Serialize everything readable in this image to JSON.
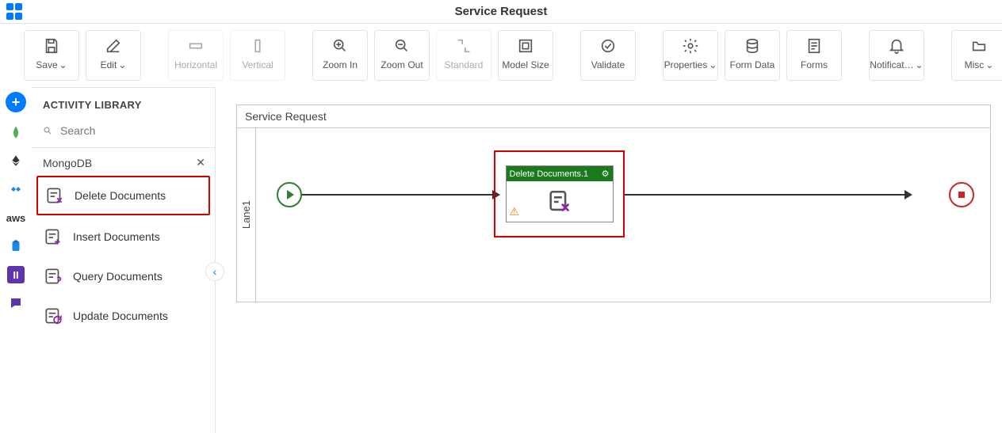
{
  "header": {
    "title": "Service Request"
  },
  "toolbar": {
    "items": [
      {
        "id": "save",
        "label": "Save",
        "chevron": true
      },
      {
        "id": "edit",
        "label": "Edit",
        "chevron": true
      },
      {
        "id": "horiz",
        "label": "Horizontal",
        "disabled": true
      },
      {
        "id": "vert",
        "label": "Vertical",
        "disabled": true
      },
      {
        "id": "zoomin",
        "label": "Zoom In"
      },
      {
        "id": "zoomout",
        "label": "Zoom Out"
      },
      {
        "id": "standard",
        "label": "Standard",
        "disabled": true
      },
      {
        "id": "modelsize",
        "label": "Model Size"
      },
      {
        "id": "validate",
        "label": "Validate"
      },
      {
        "id": "props",
        "label": "Properties",
        "chevron": true
      },
      {
        "id": "formdata",
        "label": "Form Data"
      },
      {
        "id": "forms",
        "label": "Forms"
      },
      {
        "id": "notif",
        "label": "Notificat…",
        "chevron": true
      },
      {
        "id": "misc",
        "label": "Misc",
        "chevron": true
      }
    ]
  },
  "sidebar": {
    "title": "ACTIVITY LIBRARY",
    "search_placeholder": "Search",
    "group": "MongoDB",
    "activities": [
      {
        "id": "delete",
        "label": "Delete Documents",
        "selected": true
      },
      {
        "id": "insert",
        "label": "Insert Documents"
      },
      {
        "id": "query",
        "label": "Query Documents"
      },
      {
        "id": "update",
        "label": "Update Documents"
      }
    ]
  },
  "rail": {
    "items": [
      {
        "id": "plus",
        "type": "plus"
      },
      {
        "id": "mongo",
        "glyph": "leaf"
      },
      {
        "id": "eth",
        "glyph": "diamond"
      },
      {
        "id": "pieces",
        "glyph": "pieces"
      },
      {
        "id": "aws",
        "glyph": "aws"
      },
      {
        "id": "clip",
        "glyph": "clipboard"
      },
      {
        "id": "ii",
        "glyph": "ii"
      },
      {
        "id": "chat",
        "glyph": "chat"
      }
    ]
  },
  "canvas": {
    "process_title": "Service Request",
    "lane_label": "Lane1",
    "node_label": "Delete Documents.1"
  }
}
